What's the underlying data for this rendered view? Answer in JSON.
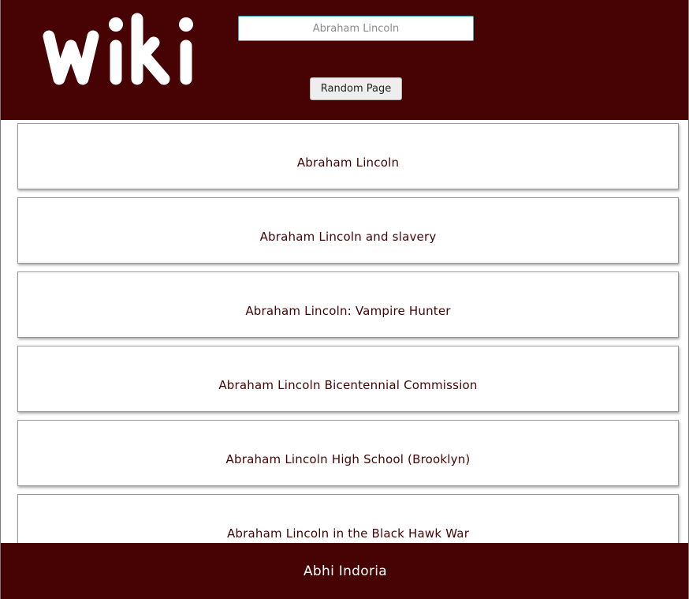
{
  "header": {
    "logo_text": "wiki",
    "search": {
      "placeholder": "Abraham Lincoln",
      "value": ""
    },
    "random_button_label": "Random Page"
  },
  "results": [
    {
      "title": "Abraham Lincoln"
    },
    {
      "title": "Abraham Lincoln and slavery"
    },
    {
      "title": "Abraham Lincoln: Vampire Hunter"
    },
    {
      "title": "Abraham Lincoln Bicentennial Commission"
    },
    {
      "title": "Abraham Lincoln High School (Brooklyn)"
    },
    {
      "title": "Abraham Lincoln in the Black Hawk War"
    }
  ],
  "footer": {
    "credit": "Abhi Indoria"
  },
  "colors": {
    "brand": "#470303",
    "card_text": "#470303",
    "search_border": "#38b2b8"
  }
}
